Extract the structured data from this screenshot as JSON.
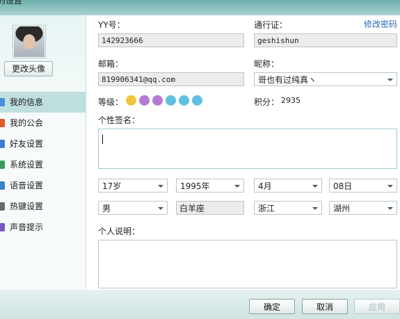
{
  "window": {
    "title": "的设置"
  },
  "profile": {
    "change_avatar_label": "更改头像"
  },
  "sidebar": {
    "items": [
      {
        "label": "我的信息",
        "icon": "user-info-icon",
        "color": "#4a90d9"
      },
      {
        "label": "我的公会",
        "icon": "guild-icon",
        "color": "#e05a2a"
      },
      {
        "label": "好友设置",
        "icon": "friends-icon",
        "color": "#3a7fd0"
      },
      {
        "label": "系统设置",
        "icon": "system-icon",
        "color": "#3b9a5b"
      },
      {
        "label": "语音设置",
        "icon": "voice-icon",
        "color": "#3a7fd0"
      },
      {
        "label": "热键设置",
        "icon": "hotkey-icon",
        "color": "#6a6a6a"
      },
      {
        "label": "声音提示",
        "icon": "sound-icon",
        "color": "#7a5ac0"
      }
    ]
  },
  "form": {
    "yy_label": "YY号：",
    "yy_value": "142923666",
    "passport_label": "通行证：",
    "passport_value": "geshishun",
    "change_password": "修改密码",
    "email_label": "邮箱：",
    "email_value": "819906341@qq.com",
    "nickname_label": "昵称：",
    "nickname_value": "哥也有过纯真ヽ",
    "level_label": "等级：",
    "level_badges": [
      "crown-icon",
      "moon-icon",
      "moon-icon",
      "diamond-icon",
      "diamond-icon",
      "diamond-icon"
    ],
    "points_label": "积分：",
    "points_value": "2935",
    "signature_label": "个性签名：",
    "signature_value": "",
    "age": "17岁",
    "year": "1995年",
    "month": "4月",
    "day": "08日",
    "gender": "男",
    "zodiac": "白羊座",
    "province": "浙江",
    "city": "湖州",
    "description_label": "个人说明："
  },
  "footer": {
    "ok": "确定",
    "cancel": "取消",
    "apply": "应用"
  },
  "colors": {
    "accent": "#2b6bb5",
    "active_nav": "#bfdfdf",
    "titlebar": "#6fb0ad"
  }
}
